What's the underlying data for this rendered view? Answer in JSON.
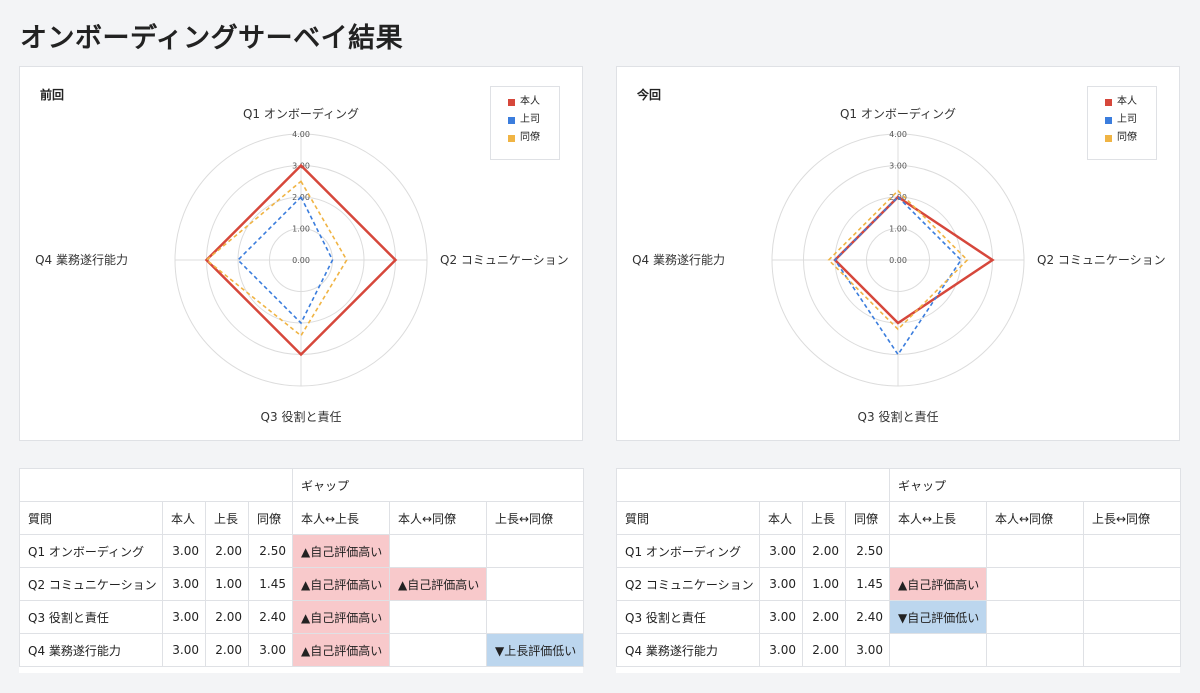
{
  "page_title": "オンボーディングサーベイ結果",
  "colors": {
    "self": "#d6473b",
    "boss": "#3b7ddd",
    "peer": "#f0b444",
    "high_bg": "#f8c9cb",
    "low_bg": "#bcd6ee"
  },
  "chart_data": [
    {
      "type": "radar",
      "title": "前回",
      "axes": [
        "Q1 オンボーディング",
        "Q2 コミュニケーション",
        "Q3 役割と責任",
        "Q4 業務遂行能力"
      ],
      "tick_labels": [
        "0.00",
        "1.00",
        "2.00",
        "3.00",
        "4.00"
      ],
      "rlim": [
        0,
        4
      ],
      "legend": [
        "本人",
        "上司",
        "同僚"
      ],
      "legend_position": "top-right",
      "series": [
        {
          "name": "本人",
          "values": [
            3.0,
            3.0,
            3.0,
            3.0
          ]
        },
        {
          "name": "上司",
          "values": [
            2.0,
            1.0,
            2.0,
            2.0
          ]
        },
        {
          "name": "同僚",
          "values": [
            2.5,
            1.45,
            2.4,
            3.0
          ]
        }
      ]
    },
    {
      "type": "radar",
      "title": "今回",
      "axes": [
        "Q1 オンボーディング",
        "Q2 コミュニケーション",
        "Q3 役割と責任",
        "Q4 業務遂行能力"
      ],
      "tick_labels": [
        "0.00",
        "1.00",
        "2.00",
        "3.00",
        "4.00"
      ],
      "rlim": [
        0,
        4
      ],
      "legend": [
        "本人",
        "上司",
        "同僚"
      ],
      "legend_position": "top-right",
      "series": [
        {
          "name": "本人",
          "values": [
            2.0,
            3.0,
            2.0,
            2.0
          ]
        },
        {
          "name": "上司",
          "values": [
            2.0,
            2.0,
            3.0,
            2.0
          ]
        },
        {
          "name": "同僚",
          "values": [
            2.2,
            2.2,
            2.2,
            2.2
          ]
        }
      ]
    }
  ],
  "tables": [
    {
      "gap_header": "ギャップ",
      "headers": [
        "質問",
        "本人",
        "上長",
        "同僚",
        "本人↔上長",
        "本人↔同僚",
        "上長↔同僚"
      ],
      "rows": [
        {
          "q": "Q1 オンボーディング",
          "self": "3.00",
          "boss": "2.00",
          "peer": "2.50",
          "g1": "▲自己評価高い",
          "g1s": "hi",
          "g2": "",
          "g2s": "",
          "g3": "",
          "g3s": ""
        },
        {
          "q": "Q2 コミュニケーション",
          "self": "3.00",
          "boss": "1.00",
          "peer": "1.45",
          "g1": "▲自己評価高い",
          "g1s": "hi",
          "g2": "▲自己評価高い",
          "g2s": "hi",
          "g3": "",
          "g3s": ""
        },
        {
          "q": "Q3 役割と責任",
          "self": "3.00",
          "boss": "2.00",
          "peer": "2.40",
          "g1": "▲自己評価高い",
          "g1s": "hi",
          "g2": "",
          "g2s": "",
          "g3": "",
          "g3s": ""
        },
        {
          "q": "Q4 業務遂行能力",
          "self": "3.00",
          "boss": "2.00",
          "peer": "3.00",
          "g1": "▲自己評価高い",
          "g1s": "hi",
          "g2": "",
          "g2s": "",
          "g3": "▼上長評価低い",
          "g3s": "lo"
        }
      ]
    },
    {
      "gap_header": "ギャップ",
      "headers": [
        "質問",
        "本人",
        "上長",
        "同僚",
        "本人↔上長",
        "本人↔同僚",
        "上長↔同僚"
      ],
      "rows": [
        {
          "q": "Q1 オンボーディング",
          "self": "3.00",
          "boss": "2.00",
          "peer": "2.50",
          "g1": "",
          "g1s": "",
          "g2": "",
          "g2s": "",
          "g3": "",
          "g3s": ""
        },
        {
          "q": "Q2 コミュニケーション",
          "self": "3.00",
          "boss": "1.00",
          "peer": "1.45",
          "g1": "▲自己評価高い",
          "g1s": "hi",
          "g2": "",
          "g2s": "",
          "g3": "",
          "g3s": ""
        },
        {
          "q": "Q3 役割と責任",
          "self": "3.00",
          "boss": "2.00",
          "peer": "2.40",
          "g1": "▼自己評価低い",
          "g1s": "lo",
          "g2": "",
          "g2s": "",
          "g3": "",
          "g3s": ""
        },
        {
          "q": "Q4 業務遂行能力",
          "self": "3.00",
          "boss": "2.00",
          "peer": "3.00",
          "g1": "",
          "g1s": "",
          "g2": "",
          "g2s": "",
          "g3": "",
          "g3s": ""
        }
      ]
    }
  ]
}
